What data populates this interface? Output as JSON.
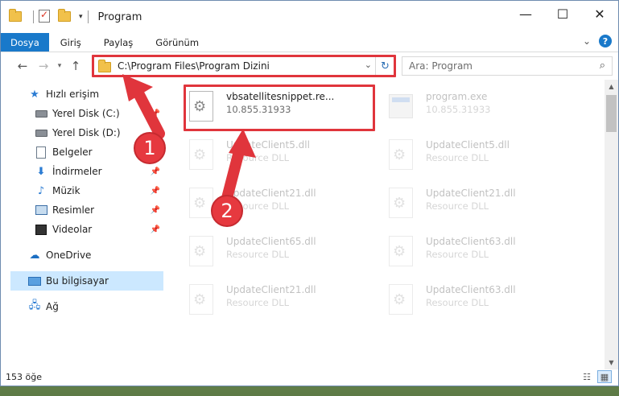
{
  "window": {
    "title": "Program"
  },
  "ribbon": {
    "tabs": [
      {
        "label": "Dosya"
      },
      {
        "label": "Giriş"
      },
      {
        "label": "Paylaş"
      },
      {
        "label": "Görünüm"
      }
    ]
  },
  "address": {
    "path": "C:\\Program Files\\Program Dizini"
  },
  "search": {
    "placeholder": "Ara: Program"
  },
  "sidebar": {
    "items": [
      {
        "label": "Hızlı erişim",
        "icon": "star-icon"
      },
      {
        "label": "Yerel Disk (C:)",
        "icon": "drive-icon"
      },
      {
        "label": "Yerel Disk (D:)",
        "icon": "drive-icon"
      },
      {
        "label": "Belgeler",
        "icon": "documents-icon"
      },
      {
        "label": "İndirmeler",
        "icon": "downloads-icon"
      },
      {
        "label": "Müzik",
        "icon": "music-icon"
      },
      {
        "label": "Resimler",
        "icon": "pictures-icon"
      },
      {
        "label": "Videolar",
        "icon": "videos-icon"
      },
      {
        "label": "OneDrive",
        "icon": "cloud-icon"
      },
      {
        "label": "Bu bilgisayar",
        "icon": "computer-icon"
      },
      {
        "label": "Ağ",
        "icon": "network-icon"
      }
    ]
  },
  "files": [
    {
      "name": "vbsatellitesnippet.re...",
      "sub": "10.855.31933"
    },
    {
      "name": "program.exe",
      "sub": "10.855.31933"
    },
    {
      "name": "UpdateClient5.dll",
      "sub": "Resource DLL"
    },
    {
      "name": "UpdateClient5.dll",
      "sub": "Resource DLL"
    },
    {
      "name": "UpdateClient21.dll",
      "sub": "Resource DLL"
    },
    {
      "name": "UpdateClient21.dll",
      "sub": "Resource DLL"
    },
    {
      "name": "UpdateClient65.dll",
      "sub": "Resource DLL"
    },
    {
      "name": "UpdateClient63.dll",
      "sub": "Resource DLL"
    },
    {
      "name": "UpdateClient21.dll",
      "sub": "Resource DLL"
    },
    {
      "name": "UpdateClient63.dll",
      "sub": "Resource DLL"
    }
  ],
  "status": {
    "count": "153 öğe"
  },
  "callouts": {
    "one": "1",
    "two": "2"
  },
  "colors": {
    "accent": "#1979ca",
    "highlight": "#e0353c",
    "selection": "#cce8ff"
  }
}
